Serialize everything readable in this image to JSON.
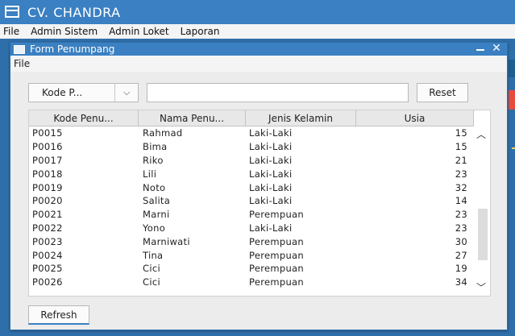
{
  "window": {
    "title": "CV. CHANDRA",
    "menu": [
      "File",
      "Admin Sistem",
      "Admin Loket",
      "Laporan"
    ]
  },
  "frame": {
    "title": "Form Penumpang",
    "menu": [
      "File"
    ],
    "close_glyph": "✕"
  },
  "filter": {
    "combo_value": "Kode P...",
    "search_value": "",
    "reset_label": "Reset"
  },
  "table": {
    "columns": [
      "Kode Penu...",
      "Nama Penu...",
      "Jenis Kelamin",
      "Usia"
    ],
    "rows": [
      [
        "P0015",
        "Rahmad",
        "Laki-Laki",
        "15"
      ],
      [
        "P0016",
        "Bima",
        "Laki-Laki",
        "15"
      ],
      [
        "P0017",
        "Riko",
        "Laki-Laki",
        "21"
      ],
      [
        "P0018",
        "Lili",
        "Laki-Laki",
        "23"
      ],
      [
        "P0019",
        "Noto",
        "Laki-Laki",
        "32"
      ],
      [
        "P0020",
        "Salita",
        "Laki-Laki",
        "14"
      ],
      [
        "P0021",
        "Marni",
        "Perempuan",
        "23"
      ],
      [
        "P0022",
        "Yono",
        "Laki-Laki",
        "23"
      ],
      [
        "P0023",
        "Marniwati",
        "Perempuan",
        "30"
      ],
      [
        "P0024",
        "Tina",
        "Perempuan",
        "27"
      ],
      [
        "P0025",
        "Cici",
        "Perempuan",
        "19"
      ],
      [
        "P0026",
        "Cici",
        "Perempuan",
        "34"
      ]
    ]
  },
  "refresh_label": "Refresh",
  "colors": {
    "accent": "#3a80c2",
    "desktop": "#2f6fa9"
  }
}
